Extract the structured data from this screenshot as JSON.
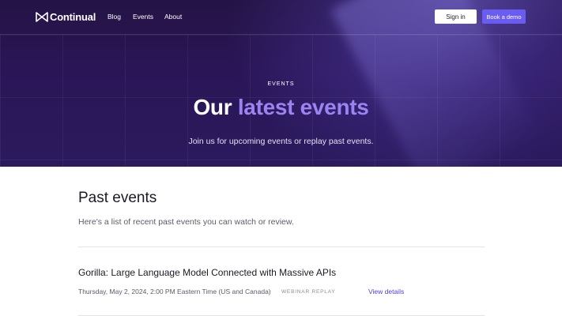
{
  "brand": {
    "name": "Continual",
    "accent": "#6a5cf0",
    "hero_bg": "#241345",
    "highlight": "#9b83f2"
  },
  "nav": {
    "links": [
      {
        "label": "Blog"
      },
      {
        "label": "Events"
      },
      {
        "label": "About"
      }
    ],
    "signin_label": "Sign in",
    "demo_label": "Book a demo"
  },
  "hero": {
    "eyebrow": "EVENTS",
    "title_prefix": "Our",
    "title_accent": "latest events",
    "subtitle": "Join us for upcoming events or replay past events."
  },
  "past": {
    "title": "Past events",
    "subtitle": "Here's a list of recent past events you can watch or review.",
    "events": [
      {
        "title": "Gorilla: Large Language Model Connected with Massive APIs",
        "date": "Thursday, May 2, 2024, 2:00 PM Eastern Time (US and Canada)",
        "type": "WEBINAR REPLAY",
        "link_label": "View details"
      }
    ]
  },
  "icons": {
    "logo": "bowtie-logo-icon"
  }
}
